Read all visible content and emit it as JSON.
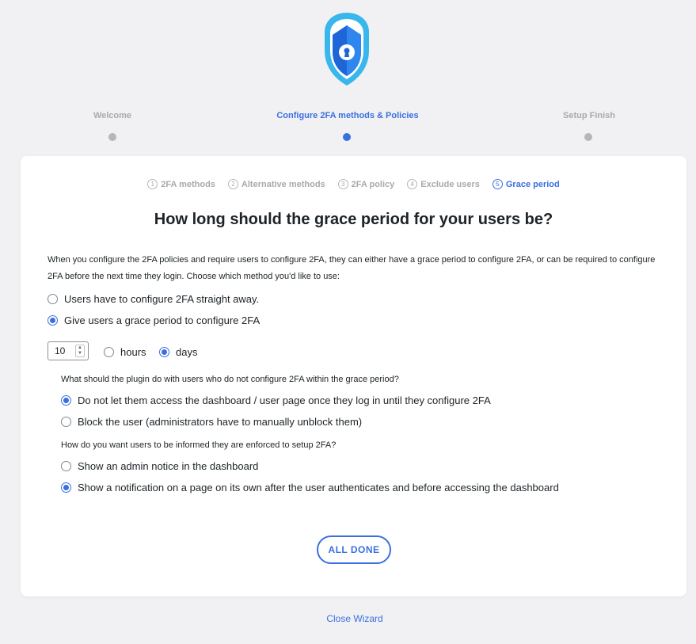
{
  "colors": {
    "accent": "#3a6fe0",
    "inactive": "#a7aaad",
    "background": "#f1f1f4",
    "card": "#ffffff"
  },
  "logo": {
    "icon": "shield-lock-icon"
  },
  "steps": [
    {
      "label": "Welcome",
      "active": false
    },
    {
      "label": "Configure 2FA methods & Policies",
      "active": true
    },
    {
      "label": "Setup Finish",
      "active": false
    }
  ],
  "substeps": [
    {
      "num": "1",
      "label": "2FA methods",
      "active": false
    },
    {
      "num": "2",
      "label": "Alternative methods",
      "active": false
    },
    {
      "num": "3",
      "label": "2FA policy",
      "active": false
    },
    {
      "num": "4",
      "label": "Exclude users",
      "active": false
    },
    {
      "num": "5",
      "label": "Grace period",
      "active": true
    }
  ],
  "heading": "How long should the grace period for your users be?",
  "intro": "When you configure the 2FA policies and require users to configure 2FA, they can either have a grace period to configure 2FA, or can be required to configure 2FA before the next time they login. Choose which method you'd like to use:",
  "method_options": [
    {
      "label": "Users have to configure 2FA straight away.",
      "checked": false
    },
    {
      "label": "Give users a grace period to configure 2FA",
      "checked": true
    }
  ],
  "grace": {
    "value": "10",
    "units": [
      {
        "label": "hours",
        "checked": false
      },
      {
        "label": "days",
        "checked": true
      }
    ]
  },
  "question1": "What should the plugin do with users who do not configure 2FA within the grace period?",
  "expire_options": [
    {
      "label": "Do not let them access the dashboard / user page once they log in until they configure 2FA",
      "checked": true
    },
    {
      "label": "Block the user (administrators have to manually unblock them)",
      "checked": false
    }
  ],
  "question2": "How do you want users to be informed they are enforced to setup 2FA?",
  "notify_options": [
    {
      "label": "Show an admin notice in the dashboard",
      "checked": false
    },
    {
      "label": "Show a notification on a page on its own after the user authenticates and before accessing the dashboard",
      "checked": true
    }
  ],
  "buttons": {
    "all_done": "ALL DONE",
    "close_wizard": "Close Wizard"
  }
}
